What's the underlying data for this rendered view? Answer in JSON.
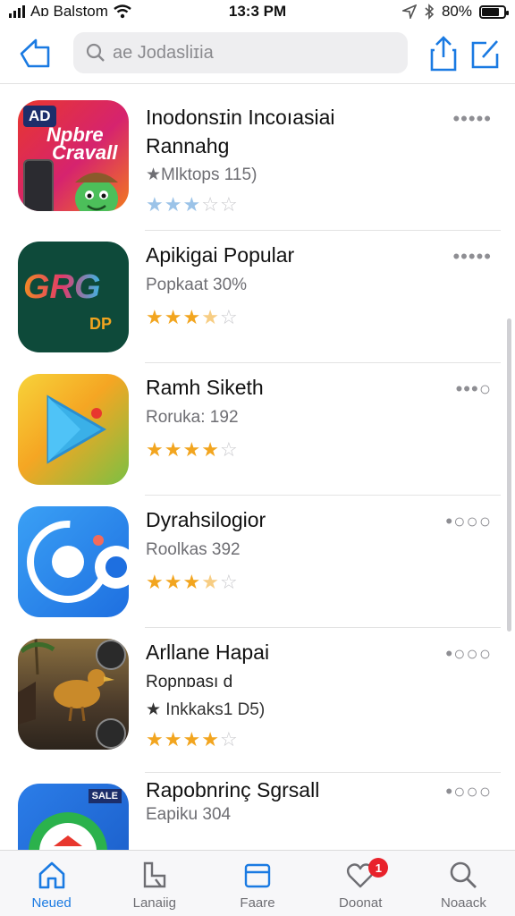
{
  "status_bar": {
    "carrier": "Aɒ Balstom",
    "time": "13:3 PM",
    "battery": "80%",
    "battery_level": 0.8
  },
  "nav": {
    "search_text": "ae Jodasliɪia",
    "back_icon": "back-arrow-icon",
    "share_icon": "share-icon",
    "edit_icon": "compose-icon"
  },
  "apps": [
    {
      "title_line1": "Inodonsɪin Incoıasiai",
      "title_line2": "Rannahg",
      "sub": "★Mlktops 115)",
      "rating": 3,
      "star_style": "blue",
      "more": "•••••",
      "icon_text_1": "AD",
      "icon_text_2": "Npbre",
      "icon_text_3": "Cravall"
    },
    {
      "title_line1": "Apikigai Popular",
      "sub": "Popkaat 30%",
      "rating": 3.5,
      "star_style": "gold",
      "more": "•••••",
      "icon_text_1": "GRG",
      "icon_text_2": "DP"
    },
    {
      "title_line1": "Ramh Siketh",
      "sub": "Roruka: 192",
      "rating": 4,
      "star_style": "gold",
      "more": "•••○"
    },
    {
      "title_line1": "Dyrahsilogior",
      "sub": "Roolkas 392",
      "rating": 3.5,
      "star_style": "gold",
      "more": "•○○○"
    },
    {
      "title_line1": "Arllane Hapai",
      "sub": "Ropnɒası d",
      "sub2": "★ Inkkaks1 D5)",
      "rating": 4,
      "star_style": "gold",
      "more": "•○○○"
    },
    {
      "title_line1": "Rapobnrinç Sgrsall",
      "sub": "Eapiku 304",
      "more": "•○○○",
      "icon_text_1": "SALE"
    }
  ],
  "tabs": [
    {
      "label": "Neued",
      "icon": "home-icon",
      "active": true
    },
    {
      "label": "Lanaiig",
      "icon": "reading-icon",
      "active": false
    },
    {
      "label": "Faare",
      "icon": "window-icon",
      "active": false
    },
    {
      "label": "Doonat",
      "icon": "heart-icon",
      "active": false,
      "badge": "1"
    },
    {
      "label": "Noaack",
      "icon": "search-icon",
      "active": false
    }
  ],
  "colors": {
    "accent": "#1a7ae2",
    "star_gold": "#f2a51f",
    "star_blue": "#9bc3e8",
    "badge": "#e8222b"
  }
}
